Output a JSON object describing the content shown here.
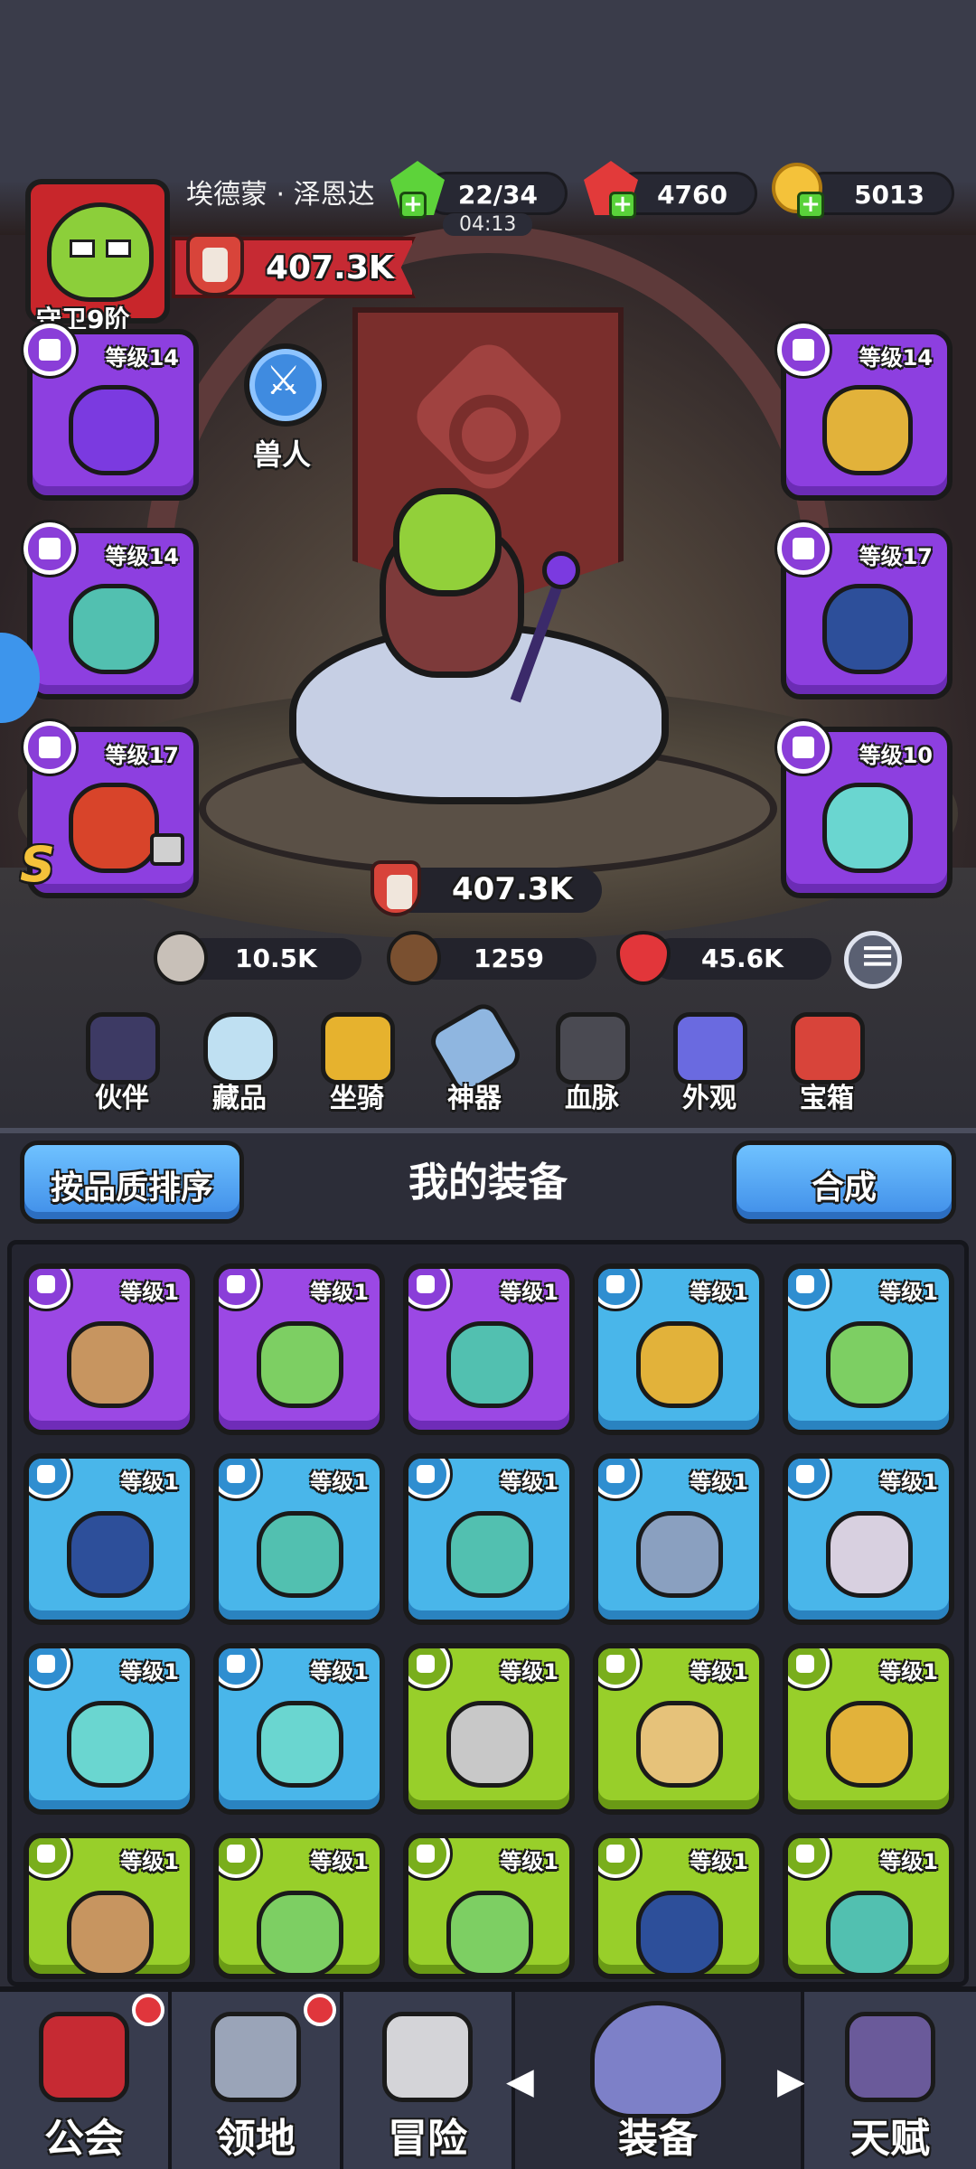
{
  "player": {
    "name": "埃德蒙 · 泽恩达",
    "rank": "守卫9阶",
    "power": "407.3K"
  },
  "currency": {
    "energy": "22/34",
    "energy_timer": "04:13",
    "gems": "4760",
    "gold": "5013"
  },
  "hero": {
    "race": "兽人",
    "power": "407.3K",
    "stats": {
      "attack": "10.5K",
      "defense": "1259",
      "hp": "45.6K"
    }
  },
  "equipped": [
    {
      "slot": "weapon",
      "level": "等级14",
      "icon": "staff-icon",
      "locked": false
    },
    {
      "slot": "armor",
      "level": "等级14",
      "icon": "chest-armor-icon",
      "locked": false
    },
    {
      "slot": "ring",
      "level": "等级14",
      "icon": "ring-icon",
      "locked": false
    },
    {
      "slot": "ring",
      "level": "等级17",
      "icon": "dark-ring-icon",
      "locked": false
    },
    {
      "slot": "necklace",
      "level": "等级17",
      "icon": "fire-amulet-icon",
      "locked": true,
      "grade": "S"
    },
    {
      "slot": "necklace",
      "level": "等级10",
      "icon": "mask-amulet-icon",
      "locked": false
    }
  ],
  "features": [
    "伙伴",
    "藏品",
    "坐骑",
    "神器",
    "血脉",
    "外观",
    "宝箱"
  ],
  "inventory": {
    "sort_button": "按品质排序",
    "title": "我的装备",
    "merge_button": "合成",
    "items": [
      {
        "rarity": "purple",
        "level": "等级1",
        "icon": "vest-icon",
        "color": "#c79560"
      },
      {
        "rarity": "purple",
        "level": "等级1",
        "icon": "green-ring-icon",
        "color": "#7dcf63"
      },
      {
        "rarity": "purple",
        "level": "等级1",
        "icon": "teal-ring-icon",
        "color": "#52c0b0"
      },
      {
        "rarity": "blue",
        "level": "等级1",
        "icon": "gold-armor-icon",
        "color": "#e2b23a"
      },
      {
        "rarity": "blue",
        "level": "等级1",
        "icon": "green-ring-icon",
        "color": "#7dcf63"
      },
      {
        "rarity": "blue",
        "level": "等级1",
        "icon": "dark-ring-icon",
        "color": "#2d4f9a"
      },
      {
        "rarity": "blue",
        "level": "等级1",
        "icon": "teal-ring-icon",
        "color": "#52c0b0"
      },
      {
        "rarity": "blue",
        "level": "等级1",
        "icon": "teal-ring-icon",
        "color": "#52c0b0"
      },
      {
        "rarity": "blue",
        "level": "等级1",
        "icon": "blue-amulet-icon",
        "color": "#8aa0c0"
      },
      {
        "rarity": "blue",
        "level": "等级1",
        "icon": "skull-amulet-icon",
        "color": "#d8d0e0"
      },
      {
        "rarity": "blue",
        "level": "等级1",
        "icon": "mask-amulet-icon",
        "color": "#6ad6d0"
      },
      {
        "rarity": "blue",
        "level": "等级1",
        "icon": "mask-amulet-icon",
        "color": "#6ad6d0"
      },
      {
        "rarity": "green",
        "level": "等级1",
        "icon": "hammer-icon",
        "color": "#c8c8c8"
      },
      {
        "rarity": "green",
        "level": "等级1",
        "icon": "bone-staff-icon",
        "color": "#e6c27a"
      },
      {
        "rarity": "green",
        "level": "等级1",
        "icon": "gold-armor-icon",
        "color": "#e2b23a"
      },
      {
        "rarity": "green",
        "level": "等级1",
        "icon": "vest-icon",
        "color": "#c79560"
      },
      {
        "rarity": "green",
        "level": "等级1",
        "icon": "green-ring-icon",
        "color": "#7dcf63"
      },
      {
        "rarity": "green",
        "level": "等级1",
        "icon": "green-ring-icon",
        "color": "#7dcf63"
      },
      {
        "rarity": "green",
        "level": "等级1",
        "icon": "dark-ring-icon",
        "color": "#2d4f9a"
      },
      {
        "rarity": "green",
        "level": "等级1",
        "icon": "teal-ring-icon",
        "color": "#52c0b0"
      }
    ]
  },
  "nav": {
    "items": [
      {
        "label": "公会",
        "icon": "guild-banner-icon",
        "notification": true
      },
      {
        "label": "领地",
        "icon": "castle-icon",
        "notification": true
      },
      {
        "label": "冒险",
        "icon": "crossed-axes-icon",
        "notification": false
      },
      {
        "label": "装备",
        "icon": "helmet-icon",
        "notification": false,
        "active": true
      },
      {
        "label": "天赋",
        "icon": "talent-book-icon",
        "notification": false
      }
    ]
  },
  "colors": {
    "purple": "#9b48e4",
    "blue": "#49b6ea",
    "green": "#98cf2a",
    "accent_red": "#c62a33",
    "button_blue": "#4a9cf0"
  }
}
